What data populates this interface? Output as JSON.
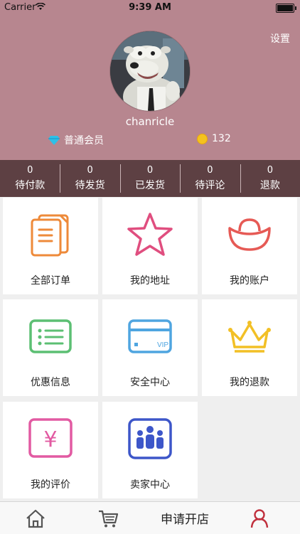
{
  "status_bar": {
    "carrier": "Carrier",
    "time": "9:39 AM"
  },
  "profile": {
    "settings_label": "设置",
    "username": "chanricle",
    "member_level": "普通会员",
    "coins": "132"
  },
  "orders": [
    {
      "count": "0",
      "label": "待付款"
    },
    {
      "count": "0",
      "label": "待发货"
    },
    {
      "count": "0",
      "label": "已发货"
    },
    {
      "count": "0",
      "label": "待评论"
    },
    {
      "count": "0",
      "label": "退款"
    }
  ],
  "menu": [
    {
      "label": "全部订单",
      "icon": "document-icon",
      "color": "#ee8a3a"
    },
    {
      "label": "我的地址",
      "icon": "star-icon",
      "color": "#e04e7f"
    },
    {
      "label": "我的账户",
      "icon": "ingot-icon",
      "color": "#e65a55"
    },
    {
      "label": "优惠信息",
      "icon": "list-icon",
      "color": "#5cbf73"
    },
    {
      "label": "安全中心",
      "icon": "vip-card-icon",
      "color": "#4fa5e0",
      "badge": "VIP"
    },
    {
      "label": "我的退款",
      "icon": "crown-icon",
      "color": "#f2c026"
    },
    {
      "label": "我的评价",
      "icon": "yen-icon",
      "color": "#e25aa2",
      "symbol": "¥"
    },
    {
      "label": "卖家中心",
      "icon": "team-icon",
      "color": "#3d56c9"
    }
  ],
  "tabbar": {
    "apply_label": "申请开店",
    "active_color": "#c0303d"
  }
}
